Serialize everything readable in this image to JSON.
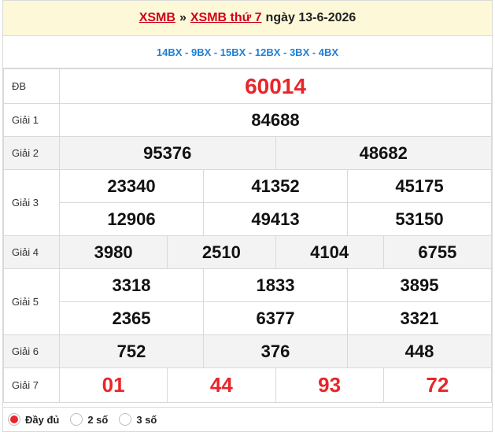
{
  "header": {
    "link1": "XSMB",
    "sep": "»",
    "link2": "XSMB thứ 7",
    "date": "ngày 13-6-2026"
  },
  "codes": "14BX - 9BX - 15BX - 12BX - 3BX - 4BX",
  "labels": {
    "db": "ĐB",
    "g1": "Giải 1",
    "g2": "Giải 2",
    "g3": "Giải 3",
    "g4": "Giải 4",
    "g5": "Giải 5",
    "g6": "Giải 6",
    "g7": "Giải 7"
  },
  "prizes": {
    "db": "60014",
    "g1": "84688",
    "g2": [
      "95376",
      "48682"
    ],
    "g3": [
      "23340",
      "41352",
      "45175",
      "12906",
      "49413",
      "53150"
    ],
    "g4": [
      "3980",
      "2510",
      "4104",
      "6755"
    ],
    "g5": [
      "3318",
      "1833",
      "3895",
      "2365",
      "6377",
      "3321"
    ],
    "g6": [
      "752",
      "376",
      "448"
    ],
    "g7": [
      "01",
      "44",
      "93",
      "72"
    ]
  },
  "footer": {
    "opt1": "Đầy đủ",
    "opt2": "2 số",
    "opt3": "3 số",
    "selected": "Đầy đủ"
  }
}
